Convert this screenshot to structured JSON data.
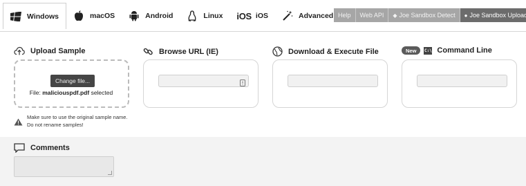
{
  "tabs": [
    {
      "label": "Windows",
      "icon": "windows-icon",
      "active": true
    },
    {
      "label": "macOS",
      "icon": "apple-icon"
    },
    {
      "label": "Android",
      "icon": "android-icon"
    },
    {
      "label": "Linux",
      "icon": "linux-icon"
    },
    {
      "label": "iOS",
      "icon": "ios-icon",
      "icon_text": "iOS"
    },
    {
      "label": "Advanced",
      "icon": "magic-wand-icon"
    }
  ],
  "toplinks": [
    {
      "label": "Help"
    },
    {
      "label": "Web API"
    },
    {
      "label": "Joe Sandbox Detect",
      "icon": "◆"
    },
    {
      "label": "Joe Sandbox Upload",
      "icon": "●"
    }
  ],
  "upload": {
    "title": "Upload Sample",
    "button": "Change file...",
    "file_prefix": "File:",
    "file_name": "maliciouspdf.pdf",
    "file_suffix": "selected",
    "warning_line1": "Make sure to use the original sample name.",
    "warning_line2": "Do not rename samples!"
  },
  "browse": {
    "title": "Browse URL (IE)",
    "url_value": ""
  },
  "download": {
    "title": "Download & Execute File",
    "url_value": ""
  },
  "command": {
    "badge": "New",
    "icon_text": "C:\\",
    "title": "Command Line",
    "value": ""
  },
  "comments": {
    "title": "Comments",
    "value": ""
  },
  "colors": {
    "accent_dark": "#454545",
    "link_bar": "#a6a6a6",
    "band": "#f3f3f3"
  }
}
